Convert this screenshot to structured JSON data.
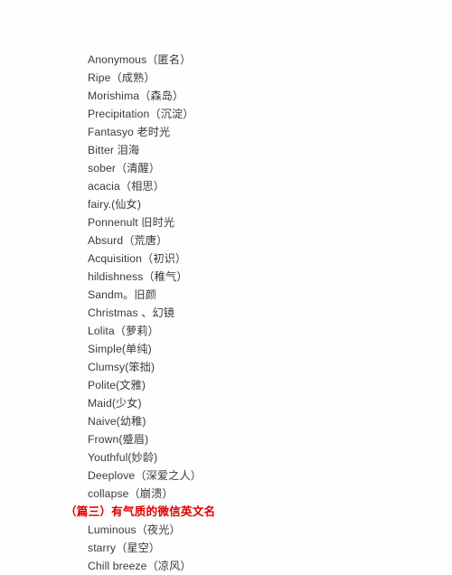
{
  "document": {
    "background_color": "#fdfefd",
    "text_color": "#3b3b3b",
    "heading_color": "#e00000",
    "blocks": [
      {
        "type": "name",
        "text": "Anonymous（匿名）"
      },
      {
        "type": "name",
        "text": "Ripe（成熟）"
      },
      {
        "type": "name",
        "text": "Morishima（森岛）"
      },
      {
        "type": "name",
        "text": "Precipitation（沉淀）"
      },
      {
        "type": "name",
        "text": "Fantasyo 老时光"
      },
      {
        "type": "name",
        "text": "Bitter 泪海"
      },
      {
        "type": "name",
        "text": "sober（清醒）"
      },
      {
        "type": "name",
        "text": "acacia（相思）"
      },
      {
        "type": "name",
        "text": "fairy.(仙女)"
      },
      {
        "type": "name",
        "text": "Ponnenult 旧时光"
      },
      {
        "type": "name",
        "text": "Absurd（荒唐）"
      },
      {
        "type": "name",
        "text": "Acquisition（初识）"
      },
      {
        "type": "name",
        "text": "hildishness（稚气）"
      },
      {
        "type": "name",
        "text": "Sandm。旧颜"
      },
      {
        "type": "name",
        "text": "Christmas 、幻镜"
      },
      {
        "type": "name",
        "text": "Lolita（萝莉）"
      },
      {
        "type": "name",
        "text": "Simple(单纯)"
      },
      {
        "type": "name",
        "text": "Clumsy(笨拙)"
      },
      {
        "type": "name",
        "text": "Polite(文雅)"
      },
      {
        "type": "name",
        "text": "Maid(少女)"
      },
      {
        "type": "name",
        "text": "Naive(幼稚)"
      },
      {
        "type": "name",
        "text": "Frown(蹙眉)"
      },
      {
        "type": "name",
        "text": "Youthful(妙龄)"
      },
      {
        "type": "name",
        "text": "Deeplove（深爱之人）"
      },
      {
        "type": "name",
        "text": "collapse（崩溃）"
      },
      {
        "type": "heading",
        "text": "（篇三）有气质的微信英文名"
      },
      {
        "type": "name",
        "text": "Luminous（夜光）"
      },
      {
        "type": "name",
        "text": "starry（星空）"
      },
      {
        "type": "name",
        "text": "Chill breeze（凉风）"
      }
    ]
  }
}
